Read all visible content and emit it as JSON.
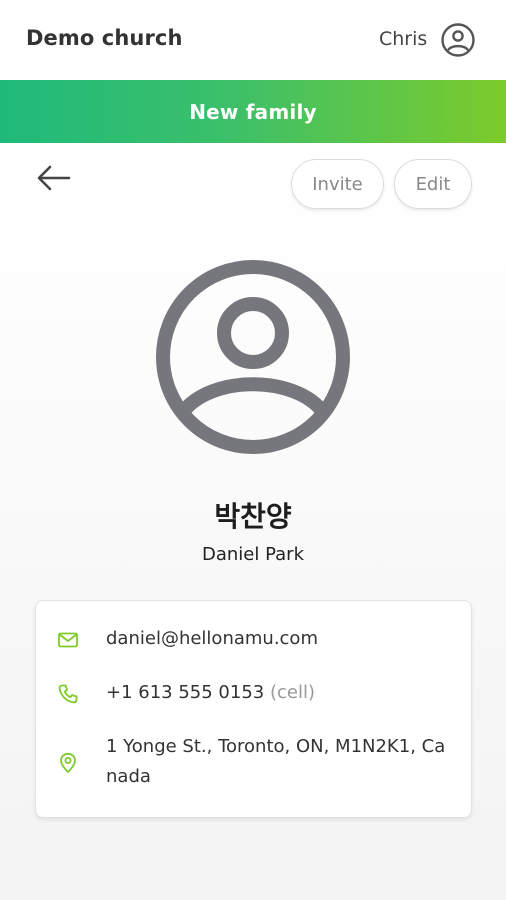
{
  "header": {
    "org_name": "Demo church",
    "user_name": "Chris"
  },
  "banner": {
    "label": "New family",
    "gradient_start": "#1fba7b",
    "gradient_end": "#7ccb2a"
  },
  "actions": {
    "invite_label": "Invite",
    "edit_label": "Edit"
  },
  "profile": {
    "name_korean": "박찬양",
    "name_english": "Daniel Park"
  },
  "contact": {
    "email": "daniel@hellonamu.com",
    "phone": "+1 613 555 0153",
    "phone_type": "(cell)",
    "address_line1": "1 Yonge St., Toronto, ON, M1N2K1, Ca",
    "address_line2": "nada",
    "icon_color": "#7ccb2a"
  },
  "icons": [
    "user-circle-icon",
    "arrow-left-icon",
    "avatar-placeholder-icon",
    "mail-icon",
    "phone-icon",
    "location-pin-icon"
  ]
}
